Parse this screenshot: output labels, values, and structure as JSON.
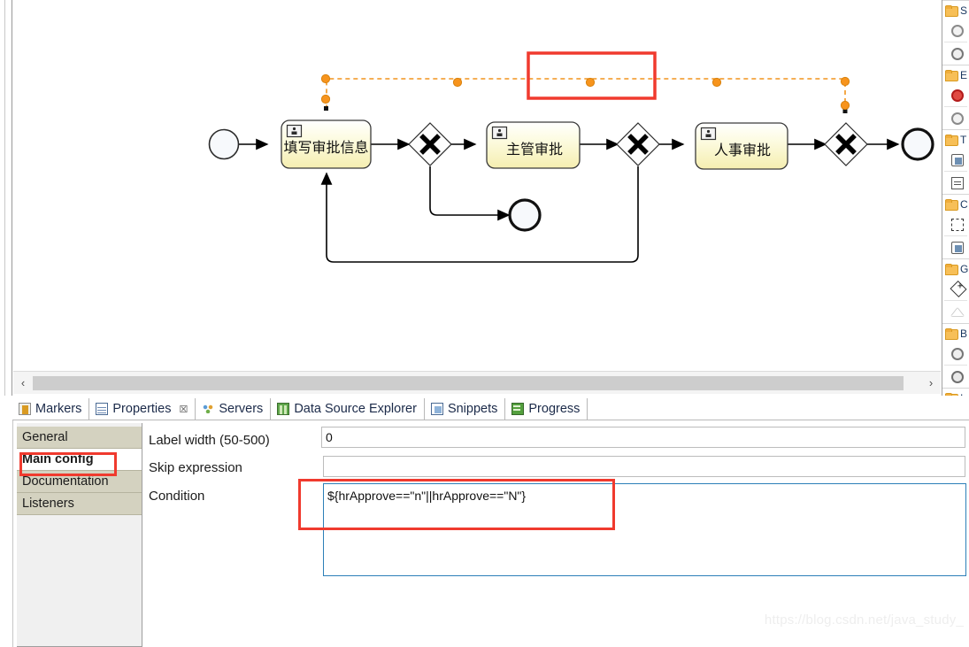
{
  "editor": {
    "scrollbar": {
      "left_arrow": "‹",
      "right_arrow": "›"
    }
  },
  "diagram": {
    "type": "bpmn-process",
    "nodes": [
      {
        "id": "start",
        "kind": "start-event",
        "label": ""
      },
      {
        "id": "task1",
        "kind": "user-task",
        "label": "填写审批信息"
      },
      {
        "id": "gw1",
        "kind": "exclusive-gateway",
        "label": ""
      },
      {
        "id": "task2",
        "kind": "user-task",
        "label": "主管审批"
      },
      {
        "id": "gw2",
        "kind": "exclusive-gateway",
        "label": ""
      },
      {
        "id": "task3",
        "kind": "user-task",
        "label": "人事审批"
      },
      {
        "id": "gw3",
        "kind": "exclusive-gateway",
        "label": ""
      },
      {
        "id": "end1",
        "kind": "end-event",
        "label": ""
      },
      {
        "id": "end2",
        "kind": "end-event",
        "label": ""
      }
    ],
    "selected_flow": {
      "id": "flow-rejected",
      "from": "gw3",
      "to": "task1",
      "style": "dashed-selected",
      "color": "#f2941d"
    },
    "annotation_box_color": "#f03a2e"
  },
  "view_tabs": [
    {
      "id": "markers",
      "label": "Markers",
      "icon": "markers-icon",
      "active": false,
      "closeable": false
    },
    {
      "id": "properties",
      "label": "Properties",
      "icon": "properties-icon",
      "active": true,
      "closeable": true,
      "close_glyph": "☒"
    },
    {
      "id": "servers",
      "label": "Servers",
      "icon": "servers-icon",
      "active": false,
      "closeable": false
    },
    {
      "id": "data-source-explorer",
      "label": "Data Source Explorer",
      "icon": "data-source-explorer-icon",
      "active": false,
      "closeable": false
    },
    {
      "id": "snippets",
      "label": "Snippets",
      "icon": "snippets-icon",
      "active": false,
      "closeable": false
    },
    {
      "id": "progress",
      "label": "Progress",
      "icon": "progress-icon",
      "active": false,
      "closeable": false
    }
  ],
  "properties": {
    "tabs": [
      {
        "id": "general",
        "label": "General",
        "selected": false
      },
      {
        "id": "main-config",
        "label": "Main config",
        "selected": true
      },
      {
        "id": "documentation",
        "label": "Documentation",
        "selected": false
      },
      {
        "id": "listeners",
        "label": "Listeners",
        "selected": false
      }
    ],
    "fields": [
      {
        "id": "label-width",
        "label": "Label width (50-500)",
        "value": "0",
        "placeholder": "",
        "focused": false,
        "multiline": false
      },
      {
        "id": "skip-expression",
        "label": "Skip expression",
        "value": "",
        "placeholder": "",
        "focused": false,
        "multiline": false
      },
      {
        "id": "condition",
        "label": "Condition",
        "value": "${hrApprove==\"n\"||hrApprove==\"N\"}",
        "placeholder": "",
        "focused": true,
        "multiline": true
      }
    ]
  },
  "palette": {
    "groups": [
      {
        "id": "startevents",
        "label": "S",
        "items": [
          "start-event-none-icon",
          "start-event-timer-icon"
        ]
      },
      {
        "id": "endevents",
        "label": "E",
        "items": [
          "end-event-none-icon",
          "end-event-error-icon"
        ]
      },
      {
        "id": "tasks",
        "label": "T",
        "items": [
          "user-task-icon",
          "script-task-icon"
        ]
      },
      {
        "id": "container",
        "label": "C",
        "items": [
          "subprocess-icon",
          "call-activity-icon"
        ]
      },
      {
        "id": "gateways",
        "label": "G",
        "items": [
          "parallel-gateway-icon",
          "exclusive-gateway-icon"
        ]
      },
      {
        "id": "boundary",
        "label": "B",
        "items": [
          "boundary-timer-icon",
          "boundary-error-icon"
        ]
      },
      {
        "id": "intermediate",
        "label": "I",
        "items": [
          "intermediate-timer-icon"
        ]
      }
    ]
  },
  "watermark": {
    "text": "https://blog.csdn.net/java_study_"
  }
}
